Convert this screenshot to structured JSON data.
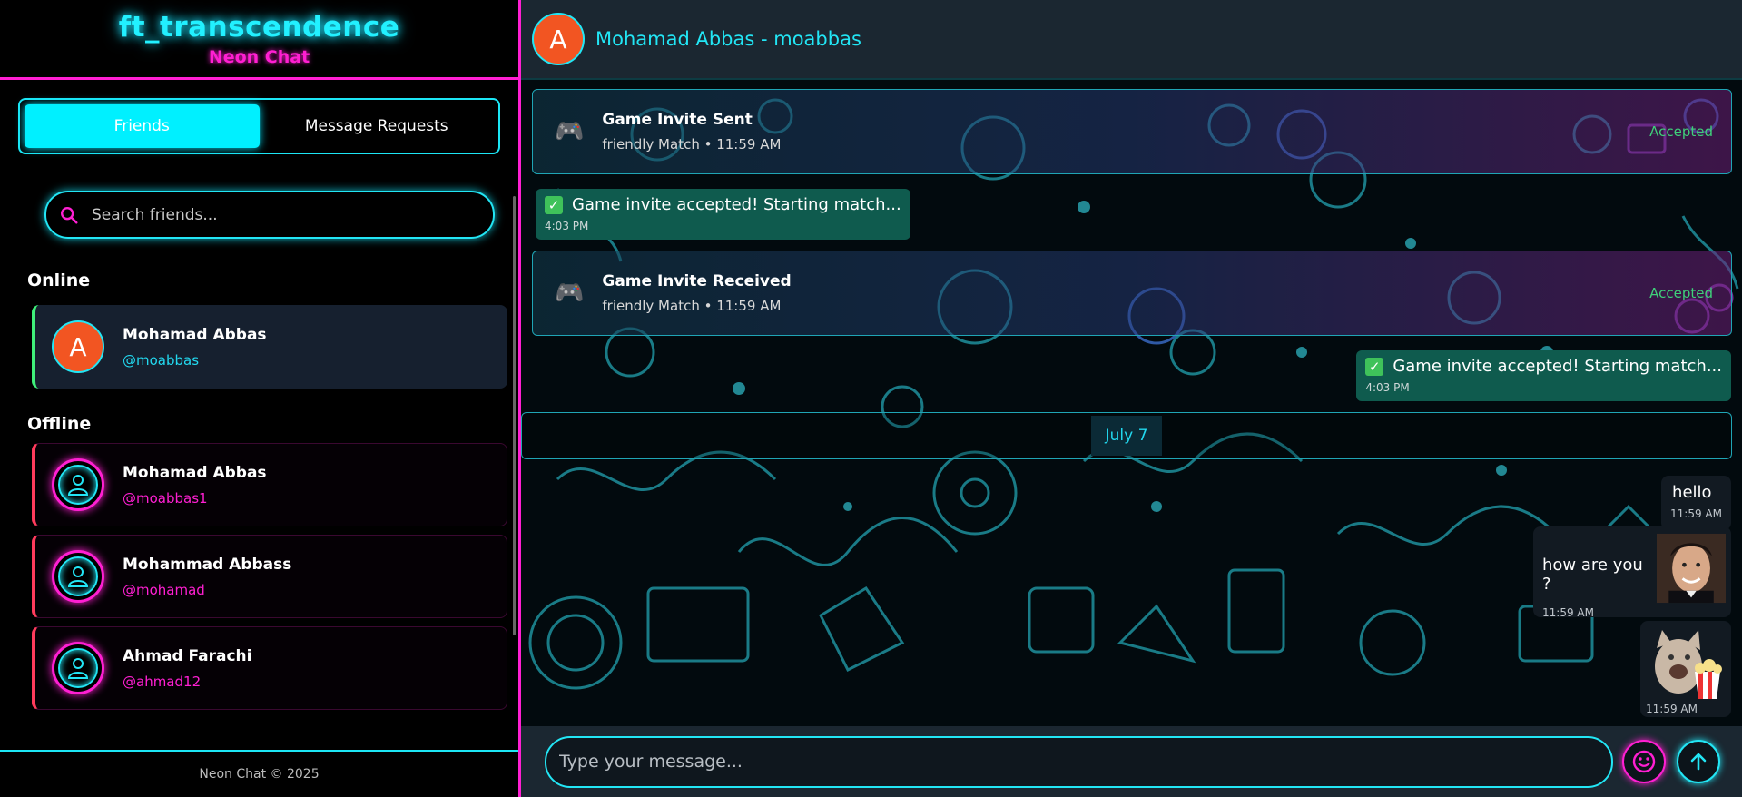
{
  "brand": {
    "title": "ft_transcendence",
    "subtitle": "Neon Chat"
  },
  "tabs": [
    {
      "label": "Friends",
      "active": true
    },
    {
      "label": "Message Requests",
      "active": false
    }
  ],
  "search": {
    "placeholder": "Search friends..."
  },
  "sections": {
    "online": "Online",
    "offline": "Offline"
  },
  "online_friends": [
    {
      "name": "Mohamad Abbas",
      "handle": "@moabbas",
      "avatar_letter": "A"
    }
  ],
  "offline_friends": [
    {
      "name": "Mohamad Abbas",
      "handle": "@moabbas1"
    },
    {
      "name": "Mohammad Abbass",
      "handle": "@mohamad"
    },
    {
      "name": "Ahmad Farachi",
      "handle": "@ahmad12"
    }
  ],
  "footer": "Neon Chat © 2025",
  "chat": {
    "header": {
      "avatar_letter": "A",
      "title": "Mohamad Abbas - moabbas"
    },
    "invites": [
      {
        "title": "Game Invite Sent",
        "sub": "friendly Match • 11:59 AM",
        "status": "Accepted"
      },
      {
        "title": "Game Invite Received",
        "sub": "friendly Match • 11:59 AM",
        "status": "Accepted"
      }
    ],
    "system_messages": [
      {
        "text": "Game invite accepted! Starting match...",
        "time": "4:03 PM"
      },
      {
        "text": "Game invite accepted! Starting match...",
        "time": "4:03 PM"
      }
    ],
    "date_separator": "July 7",
    "messages": [
      {
        "text": "hello",
        "time": "11:59 AM"
      },
      {
        "text": "how are you ?",
        "time": "11:59 AM"
      },
      {
        "text": "",
        "time": "11:59 AM"
      }
    ],
    "composer": {
      "placeholder": "Type your message..."
    }
  },
  "colors": {
    "cyan": "#22e6f5",
    "magenta": "#ff1fd2",
    "online": "#3ff07a",
    "offline": "#ff3b5c",
    "accepted": "#3fd07a"
  }
}
